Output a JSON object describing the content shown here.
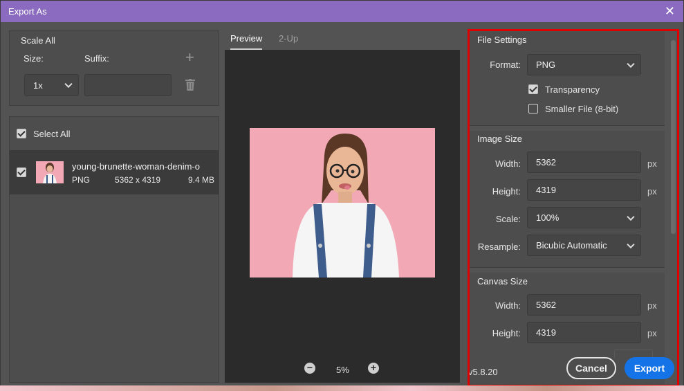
{
  "window": {
    "title": "Export As"
  },
  "scale_all": {
    "title": "Scale All",
    "size_label": "Size:",
    "suffix_label": "Suffix:",
    "size_value": "1x",
    "suffix_value": ""
  },
  "files": {
    "select_all_label": "Select All",
    "items": [
      {
        "name": "young-brunette-woman-denim-o",
        "format": "PNG",
        "dimensions": "5362 x 4319",
        "size": "9.4 MB"
      }
    ]
  },
  "preview": {
    "tabs": [
      "Preview",
      "2-Up"
    ],
    "zoom": "5%"
  },
  "file_settings": {
    "title": "File Settings",
    "format_label": "Format:",
    "format_value": "PNG",
    "transparency_label": "Transparency",
    "smaller_file_label": "Smaller File (8-bit)"
  },
  "image_size": {
    "title": "Image Size",
    "width_label": "Width:",
    "width_value": "5362",
    "height_label": "Height:",
    "height_value": "4319",
    "scale_label": "Scale:",
    "scale_value": "100%",
    "resample_label": "Resample:",
    "resample_value": "Bicubic Automatic",
    "unit": "px"
  },
  "canvas_size": {
    "title": "Canvas Size",
    "width_label": "Width:",
    "width_value": "5362",
    "height_label": "Height:",
    "height_value": "4319",
    "unit": "px"
  },
  "footer": {
    "version": "v5.8.20",
    "cancel_label": "Cancel",
    "export_label": "Export"
  },
  "colors": {
    "title_bar": "#8b6bbf",
    "export_button": "#1473e6",
    "highlight_frame": "#e00000",
    "preview_background": "#f2a9b5"
  }
}
